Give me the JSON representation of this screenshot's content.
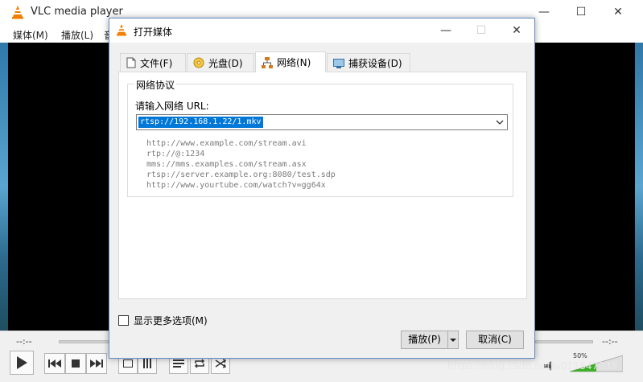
{
  "vlc": {
    "title": "VLC media player",
    "menu": [
      "媒体(M)",
      "播放(L)",
      "音"
    ],
    "time_left": "--:--",
    "time_right": "--:--",
    "volume_pct": "50%",
    "watermark": "https://blog.csdn.net/u011847038"
  },
  "dialog": {
    "title": "打开媒体",
    "tabs": [
      {
        "label": "文件(F)",
        "icon": "file-icon"
      },
      {
        "label": "光盘(D)",
        "icon": "disc-icon"
      },
      {
        "label": "网络(N)",
        "icon": "network-icon"
      },
      {
        "label": "捕获设备(D)",
        "icon": "capture-icon"
      }
    ],
    "active_tab": "网络(N)",
    "group_title": "网络协议",
    "url_label": "请输入网络 URL:",
    "url_value": "rtsp://192.168.1.22/1.mkv",
    "examples": [
      "http://www.example.com/stream.avi",
      "rtp://@:1234",
      "mms://mms.examples.com/stream.asx",
      "rtsp://server.example.org:8080/test.sdp",
      "http://www.yourtube.com/watch?v=gg64x"
    ],
    "more_options": "显示更多选项(M)",
    "more_options_checked": false,
    "play_button": "播放(P)",
    "cancel_button": "取消(C)"
  },
  "colors": {
    "selection": "#0078d7",
    "vlc_orange": "#f07d00",
    "dialog_border": "#5f8dc7"
  }
}
